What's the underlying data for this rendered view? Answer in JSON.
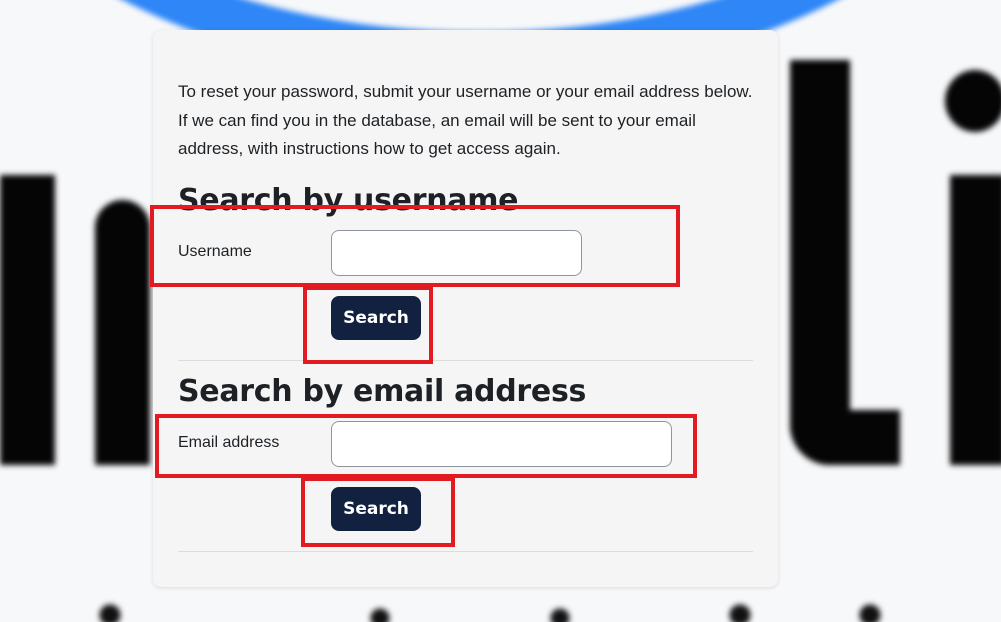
{
  "intro_text": "To reset your password, submit your username or your email address below. If we can find you in the database, an email will be sent to your email address, with instructions how to get access again.",
  "username_section": {
    "title": "Search by username",
    "field_label": "Username",
    "field_value": "",
    "button_label": "Search"
  },
  "email_section": {
    "title": "Search by email address",
    "field_label": "Email address",
    "field_value": "",
    "button_label": "Search"
  },
  "colors": {
    "button_bg": "#11213f",
    "highlight": "#e21b23",
    "background_arc": "#2f86f6"
  }
}
